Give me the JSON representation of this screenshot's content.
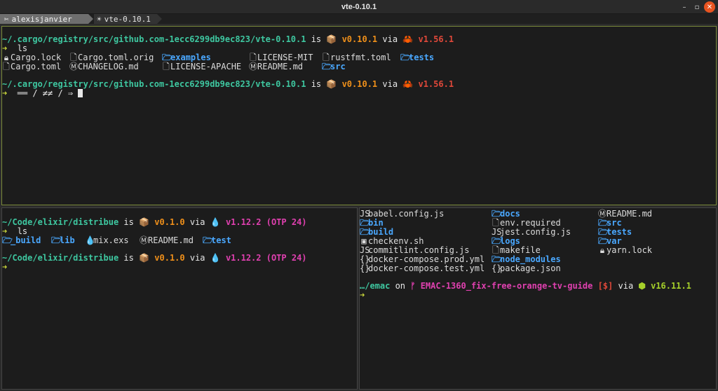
{
  "window": {
    "title": "vte-0.10.1",
    "controls": [
      "–",
      "▫",
      "✕"
    ]
  },
  "tabs": [
    {
      "label": "alexisjanvier",
      "icon": "tools-icon"
    },
    {
      "label": "vte-0.10.1",
      "icon": "bug-icon"
    }
  ],
  "top": {
    "prompt1": {
      "path": "~/.cargo/registry/src/github.com-1ecc6299db9ec823/vte-0.10.1",
      "is": " is ",
      "pkg": "v0.10.1",
      "via": " via ",
      "rust": "v1.56.1"
    },
    "cmd1": "ls",
    "files": [
      {
        "name": "Cargo.lock",
        "icon": "lock-icon",
        "kind": "file"
      },
      {
        "name": "Cargo.toml.orig",
        "icon": "file-icon",
        "kind": "file"
      },
      {
        "name": "examples",
        "icon": "folder-icon",
        "kind": "dir"
      },
      {
        "name": "LICENSE-MIT",
        "icon": "file-icon",
        "kind": "file"
      },
      {
        "name": "rustfmt.toml",
        "icon": "file-icon",
        "kind": "file"
      },
      {
        "name": "tests",
        "icon": "folder-icon",
        "kind": "dir"
      },
      {
        "name": "Cargo.toml",
        "icon": "file-icon",
        "kind": "file"
      },
      {
        "name": "CHANGELOG.md",
        "icon": "markdown-icon",
        "kind": "file"
      },
      {
        "name": "LICENSE-APACHE",
        "icon": "file-icon",
        "kind": "file"
      },
      {
        "name": "README.md",
        "icon": "markdown-icon",
        "kind": "file"
      },
      {
        "name": "src",
        "icon": "folder-icon",
        "kind": "dir"
      }
    ],
    "prompt2": {
      "path": "~/.cargo/registry/src/github.com-1ecc6299db9ec823/vte-0.10.1",
      "is": " is ",
      "pkg": "v0.10.1",
      "via": " via ",
      "rust": "v1.56.1"
    },
    "input2": "══ / ≠≠ / ⇒ "
  },
  "bottom_left": {
    "prompt1": {
      "path": "~/Code/elixir/distribue",
      "is": " is ",
      "pkg": "v0.1.0",
      "via": " via ",
      "elixir": "v1.12.2 (OTP 24)"
    },
    "cmd1": "ls",
    "files": [
      {
        "name": "_build",
        "icon": "folder-icon",
        "kind": "dir"
      },
      {
        "name": "lib",
        "icon": "folder-icon",
        "kind": "dir"
      },
      {
        "name": "mix.exs",
        "icon": "drop-icon",
        "kind": "file"
      },
      {
        "name": "README.md",
        "icon": "markdown-icon",
        "kind": "file"
      },
      {
        "name": "test",
        "icon": "folder-icon",
        "kind": "dir"
      }
    ],
    "prompt2": {
      "path": "~/Code/elixir/distribue",
      "is": " is ",
      "pkg": "v0.1.0",
      "via": " via ",
      "elixir": "v1.12.2 (OTP 24)"
    }
  },
  "bottom_right": {
    "col1": [
      {
        "name": "babel.config.js",
        "icon": "js-icon",
        "kind": "file"
      },
      {
        "name": "bin",
        "icon": "folder-icon",
        "kind": "dir"
      },
      {
        "name": "build",
        "icon": "folder-icon",
        "kind": "dir"
      },
      {
        "name": "checkenv.sh",
        "icon": "terminal-icon",
        "kind": "file"
      },
      {
        "name": "commitlint.config.js",
        "icon": "js-icon",
        "kind": "file"
      },
      {
        "name": "docker-compose.prod.yml",
        "icon": "braces-icon",
        "kind": "file"
      },
      {
        "name": "docker-compose.test.yml",
        "icon": "braces-icon",
        "kind": "file"
      }
    ],
    "col2": [
      {
        "name": "docs",
        "icon": "folder-icon",
        "kind": "dir"
      },
      {
        "name": "env.required",
        "icon": "file-icon",
        "kind": "file"
      },
      {
        "name": "jest.config.js",
        "icon": "js-icon",
        "kind": "file"
      },
      {
        "name": "logs",
        "icon": "folder-icon",
        "kind": "dir"
      },
      {
        "name": "makefile",
        "icon": "file-icon",
        "kind": "file"
      },
      {
        "name": "node_modules",
        "icon": "folder-icon",
        "kind": "dir"
      },
      {
        "name": "package.json",
        "icon": "braces-icon",
        "kind": "file"
      }
    ],
    "col3": [
      {
        "name": "README.md",
        "icon": "markdown-icon",
        "kind": "file"
      },
      {
        "name": "src",
        "icon": "folder-icon",
        "kind": "dir"
      },
      {
        "name": "tests",
        "icon": "folder-icon",
        "kind": "dir"
      },
      {
        "name": "var",
        "icon": "folder-icon",
        "kind": "dir"
      },
      {
        "name": "yarn.lock",
        "icon": "lock-icon",
        "kind": "file"
      }
    ],
    "prompt": {
      "path": "…/emac",
      "on": " on ",
      "branch": "EMAC-1360_fix-free-orange-tv-guide",
      "status": "[$]",
      "via": " via ",
      "node": "v16.11.1"
    }
  },
  "glyphs": {
    "arrow": "➜",
    "pkg": "📦",
    "crab": "🦀",
    "drop": "💧",
    "branch": "ᚠ",
    "node": "⬢"
  }
}
